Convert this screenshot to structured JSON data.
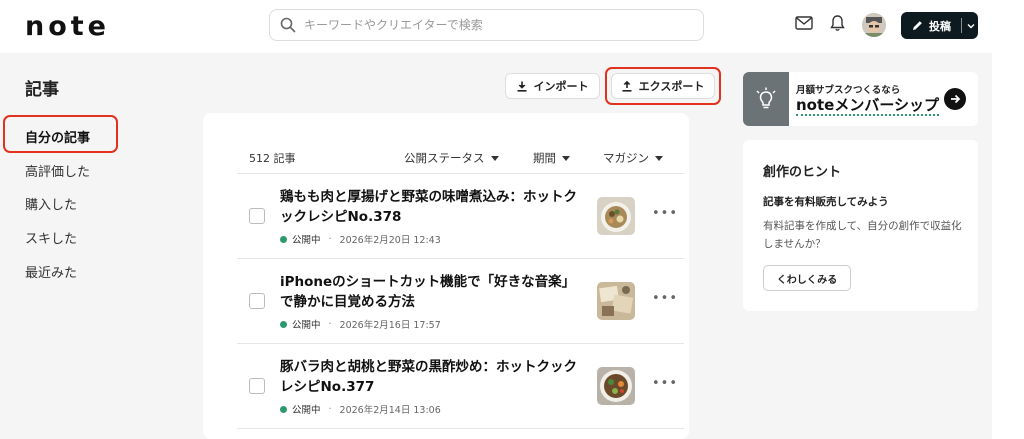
{
  "header": {
    "logo": "note",
    "search_placeholder": "キーワードやクリエイターで検索",
    "post_label": "投稿"
  },
  "sidebar": {
    "title": "記事",
    "items": [
      {
        "label": "自分の記事",
        "active": true
      },
      {
        "label": "高評価した",
        "active": false
      },
      {
        "label": "購入した",
        "active": false
      },
      {
        "label": "スキした",
        "active": false
      },
      {
        "label": "最近みた",
        "active": false
      }
    ]
  },
  "toolbar": {
    "import_label": "インポート",
    "export_label": "エクスポート"
  },
  "articles_panel": {
    "count": "512 記事",
    "filters": [
      "公開ステータス",
      "期間",
      "マガジン"
    ],
    "articles": [
      {
        "title": "鶏もも肉と厚揚げと野菜の味噌煮込み：ホットクックレシピNo.378",
        "status": "公開中",
        "date": "2026年2月20日 12:43",
        "thumb_icon": "food-photo-icon"
      },
      {
        "title": "iPhoneのショートカット機能で「好きな音楽」で静かに目覚める方法",
        "status": "公開中",
        "date": "2026年2月16日 17:57",
        "thumb_icon": "desk-photo-icon"
      },
      {
        "title": "豚バラ肉と胡桃と野菜の黒酢炒め：ホットクックレシピNo.377",
        "status": "公開中",
        "date": "2026年2月14日 13:06",
        "thumb_icon": "food-photo-icon"
      }
    ]
  },
  "promo": {
    "subtitle": "月額サブスクつくるなら",
    "title": "noteメンバーシップ"
  },
  "hint": {
    "title": "創作のヒント",
    "heading": "記事を有料販売してみよう",
    "body": "有料記事を作成して、自分の創作で収益化しませんか？",
    "button": "くわしくみる"
  },
  "colors": {
    "accent_dark": "#0d1a1f",
    "status_green": "#2c9a6c",
    "highlight_red": "#e0321e"
  }
}
